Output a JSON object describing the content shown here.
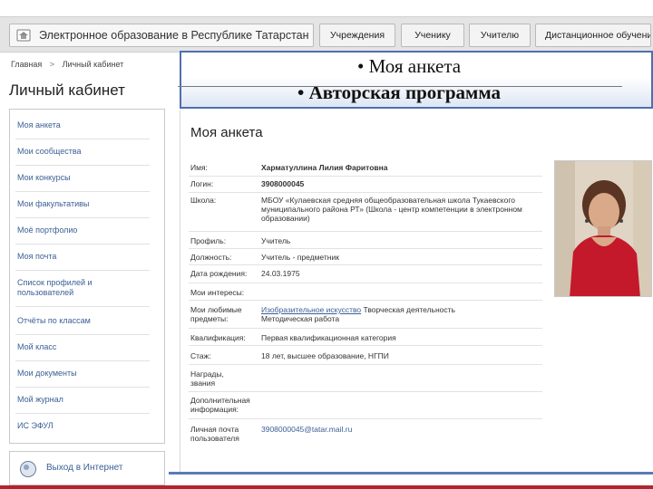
{
  "topbar": {
    "portal_title": "Электронное образование в Республике Татарстан",
    "tabs": [
      "Учреждения",
      "Ученику",
      "Учителю",
      "Дистанционное обучение"
    ]
  },
  "breadcrumb": {
    "home": "Главная",
    "separator": ">",
    "current": "Личный кабинет"
  },
  "cabinet_title": "Личный кабинет",
  "slide": {
    "line1": "• Моя анкета",
    "line2": "• Авторская программа"
  },
  "sidebar": {
    "items": [
      "Моя анкета",
      "Мои сообщества",
      "Мои конкурсы",
      "Мои факультативы",
      "Моё портфолио",
      "Моя почта",
      "Список профилей и пользователей",
      "Отчёты по классам",
      "Мой класс",
      "Мои документы",
      "Мой журнал",
      "ИС ЭФУЛ"
    ],
    "logout": "Выход в Интернет"
  },
  "profile": {
    "heading": "Моя анкета",
    "fields": [
      {
        "label": "Имя:",
        "value": "Харматуллина Лилия Фаритовна"
      },
      {
        "label": "Логин:",
        "value": "3908000045"
      },
      {
        "label": "Школа:",
        "value": "МБОУ «Кулаевская средняя общеобразовательная школа Тукаевского муниципального района РТ» (Школа - центр компетенции в электронном образовании)"
      },
      {
        "label": "Профиль:",
        "value": "Учитель"
      },
      {
        "label": "Должность:",
        "value": "Учитель - предметник"
      },
      {
        "label": "Дата рождения:",
        "value": "24.03.1975"
      },
      {
        "label": "Мои интересы:",
        "value": ""
      },
      {
        "label": "Мои любимые предметы:",
        "value_link": "Изобразительное искусство",
        "value": " Творческая деятельность Методическая работа"
      },
      {
        "label": "Квалификация:",
        "value": "Первая квалификационная категория"
      },
      {
        "label": "Стаж:",
        "value": "18 лет, высшее образование, НГПИ"
      },
      {
        "label": "Награды, звания",
        "value": ""
      },
      {
        "label": "Дополнительная информация:",
        "value": ""
      },
      {
        "label": "Личная почта пользователя",
        "value": "3908000045@tatar.mail.ru"
      }
    ]
  }
}
